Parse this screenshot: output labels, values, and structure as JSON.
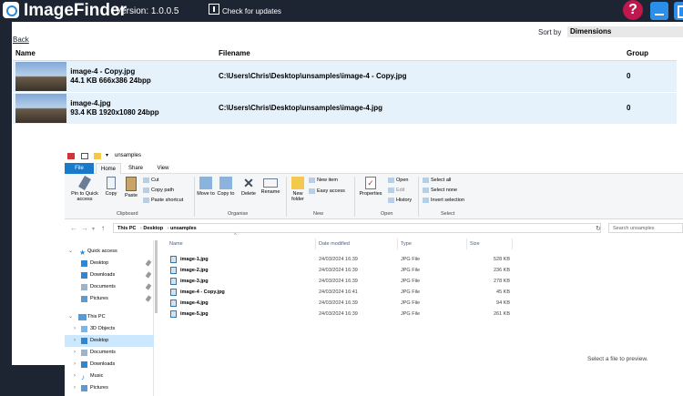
{
  "app": {
    "title": "ImageFinder",
    "version": "Version: 1.0.0.5",
    "check_updates": "Check for updates",
    "help_glyph": "?",
    "back": "Back",
    "sort_by_label": "Sort by",
    "sort_by_value": "Dimensions",
    "table": {
      "headers": [
        "Name",
        "Filename",
        "Group"
      ],
      "rows": [
        {
          "name": "image-4 - Copy.jpg",
          "meta": "44.1 KB  666x386  24bpp",
          "filename": "C:\\Users\\Chris\\Desktop\\unsamples\\image-4 - Copy.jpg",
          "group": "0"
        },
        {
          "name": "image-4.jpg",
          "meta": "93.4 KB  1920x1080  24bpp",
          "filename": "C:\\Users\\Chris\\Desktop\\unsamples\\image-4.jpg",
          "group": "0"
        }
      ]
    }
  },
  "explorer": {
    "window_title": "unsamples",
    "tabs": [
      "File",
      "Home",
      "Share",
      "View"
    ],
    "ribbon": {
      "clipboard": {
        "label": "Clipboard",
        "pin": "Pin to Quick access",
        "copy": "Copy",
        "paste": "Paste",
        "cut": "Cut",
        "copy_path": "Copy path",
        "paste_shortcut": "Paste shortcut"
      },
      "organise": {
        "label": "Organise",
        "move_to": "Move to",
        "copy_to": "Copy to",
        "delete": "Delete",
        "rename": "Rename"
      },
      "new": {
        "label": "New",
        "new_folder": "New folder",
        "new_item": "New item",
        "easy_access": "Easy access"
      },
      "open": {
        "label": "Open",
        "properties": "Properties",
        "open": "Open",
        "edit": "Edit",
        "history": "History"
      },
      "select": {
        "label": "Select",
        "select_all": "Select all",
        "select_none": "Select none",
        "invert": "Invert selection"
      }
    },
    "address": [
      "This PC",
      "Desktop",
      "unsamples"
    ],
    "search_placeholder": "Search unsamples",
    "nav": {
      "quick_access": "Quick access",
      "quick_items": [
        "Desktop",
        "Downloads",
        "Documents",
        "Pictures"
      ],
      "this_pc": "This PC",
      "pc_items": [
        "3D Objects",
        "Desktop",
        "Documents",
        "Downloads",
        "Music",
        "Pictures"
      ]
    },
    "columns": [
      "Name",
      "Date modified",
      "Type",
      "Size"
    ],
    "files": [
      {
        "name": "image-1.jpg",
        "date": "24/03/2024 16:39",
        "type": "JPG File",
        "size": "528 KB"
      },
      {
        "name": "image-2.jpg",
        "date": "24/03/2024 16:39",
        "type": "JPG File",
        "size": "236 KB"
      },
      {
        "name": "image-3.jpg",
        "date": "24/03/2024 16:39",
        "type": "JPG File",
        "size": "278 KB"
      },
      {
        "name": "image-4 - Copy.jpg",
        "date": "24/03/2024 16:41",
        "type": "JPG File",
        "size": "45 KB"
      },
      {
        "name": "image-4.jpg",
        "date": "24/03/2024 16:39",
        "type": "JPG File",
        "size": "94 KB"
      },
      {
        "name": "image-5.jpg",
        "date": "24/03/2024 16:39",
        "type": "JPG File",
        "size": "261 KB"
      }
    ],
    "preview_message": "Select a file to preview."
  }
}
